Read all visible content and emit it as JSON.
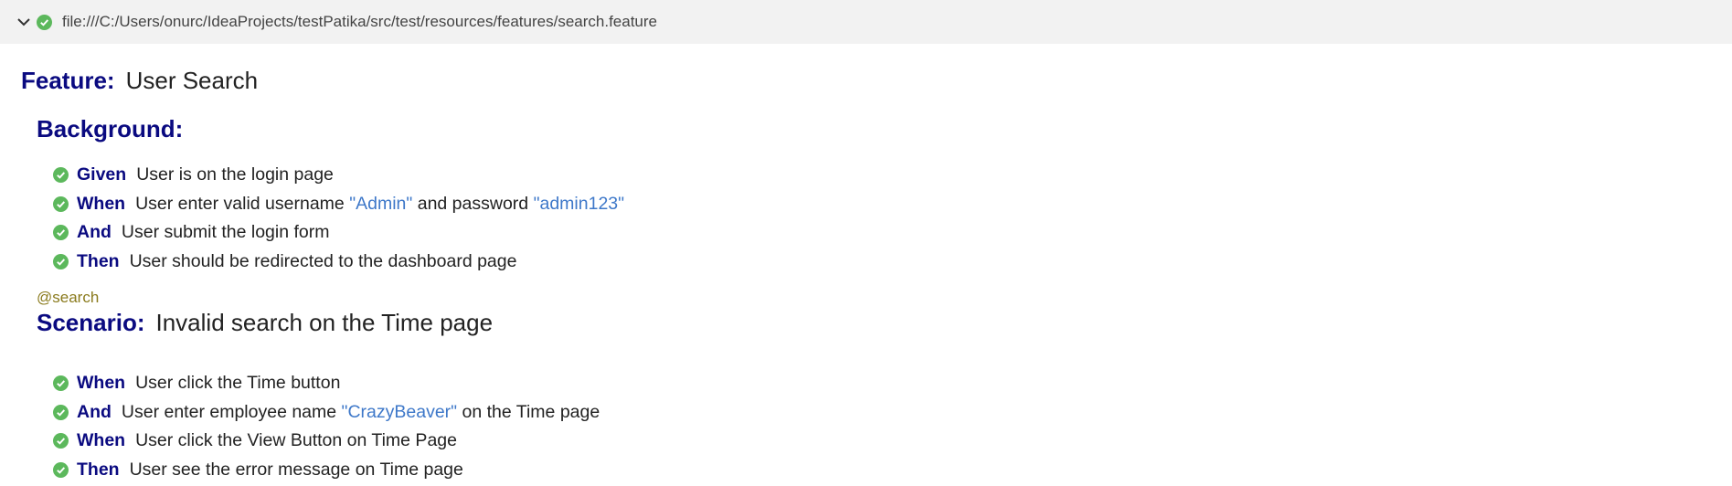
{
  "header": {
    "file_path": "file:///C:/Users/onurc/IdeaProjects/testPatika/src/test/resources/features/search.feature",
    "status_icon": "check-circle-icon",
    "toggle_icon": "chevron-down-icon"
  },
  "colors": {
    "keyword": "#0a0a80",
    "string": "#3e78c9",
    "tag": "#8a7a1c",
    "pass": "#5cb85c",
    "header_bg": "#f2f2f2"
  },
  "feature": {
    "keyword": "Feature:",
    "name": "User Search"
  },
  "background": {
    "keyword": "Background:",
    "steps": [
      {
        "keyword": "Given",
        "t1": "User is on the login page"
      },
      {
        "keyword": "When",
        "t1": "User enter valid username ",
        "s1": "\"Admin\"",
        "t2": " and password ",
        "s2": "\"admin123\""
      },
      {
        "keyword": "And",
        "t1": "User submit the login form"
      },
      {
        "keyword": "Then",
        "t1": "User should be redirected to the dashboard page"
      }
    ]
  },
  "scenario": {
    "tag": "@search",
    "keyword": "Scenario:",
    "name": "Invalid search on the Time page",
    "steps": [
      {
        "keyword": "When",
        "t1": "User click the Time button"
      },
      {
        "keyword": "And",
        "t1": "User enter employee name ",
        "s1": "\"CrazyBeaver\"",
        "t2": " on the Time page"
      },
      {
        "keyword": "When",
        "t1": "User click the View Button on Time Page"
      },
      {
        "keyword": "Then",
        "t1": "User see the error message on Time page"
      }
    ]
  }
}
